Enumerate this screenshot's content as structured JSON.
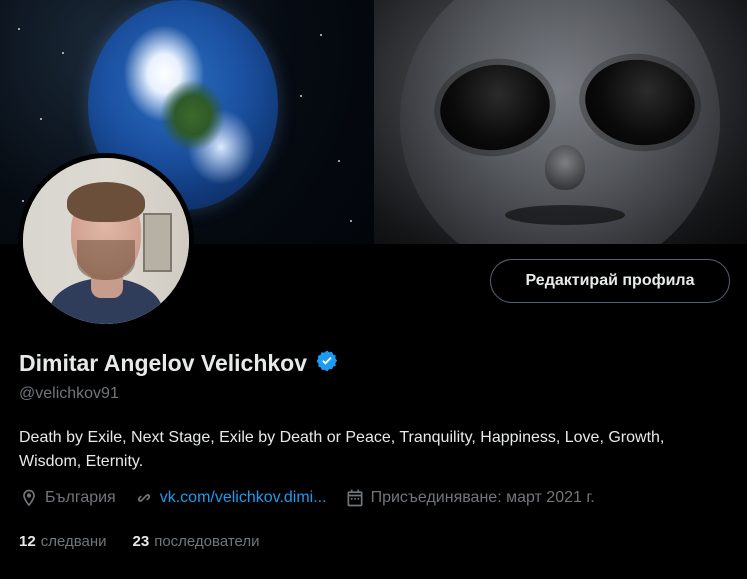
{
  "profile": {
    "display_name": "Dimitar Angelov Velichkov",
    "handle": "@velichkov91",
    "bio": "Death by Exile, Next Stage, Exile by Death or Peace, Tranquility, Happiness, Love, Growth, Wisdom, Eternity.",
    "location": "България",
    "website": "vk.com/velichkov.dimi...",
    "joined": "Присъединяване: март 2021 г.",
    "following_count": "12",
    "following_label": "следвани",
    "followers_count": "23",
    "followers_label": "последователи",
    "verified": true
  },
  "actions": {
    "edit_profile_label": "Редактирай профила"
  },
  "icons": {
    "verified": "verified-badge-icon",
    "location": "location-pin-icon",
    "link": "link-icon",
    "calendar": "calendar-icon"
  },
  "colors": {
    "background": "#000000",
    "primary_text": "#e7e9ea",
    "secondary_text": "#71767b",
    "accent": "#1d9bf0",
    "border": "#536471"
  }
}
